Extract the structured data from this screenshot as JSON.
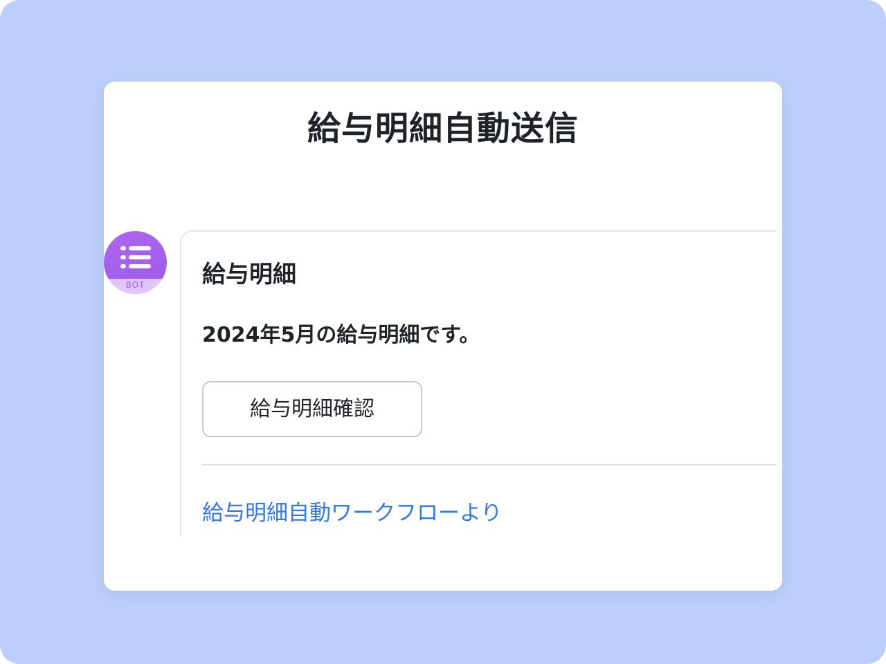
{
  "card": {
    "title": "給与明細自動送信"
  },
  "bot": {
    "avatar_icon": "list-icon",
    "badge": "BOT",
    "accent_color": "#9b5ae8"
  },
  "message": {
    "title": "給与明細",
    "body": "2024年5月の給与明細です。",
    "button_label": "給与明細確認",
    "footer_link": "給与明細自動ワークフローより",
    "link_color": "#3577e8"
  }
}
